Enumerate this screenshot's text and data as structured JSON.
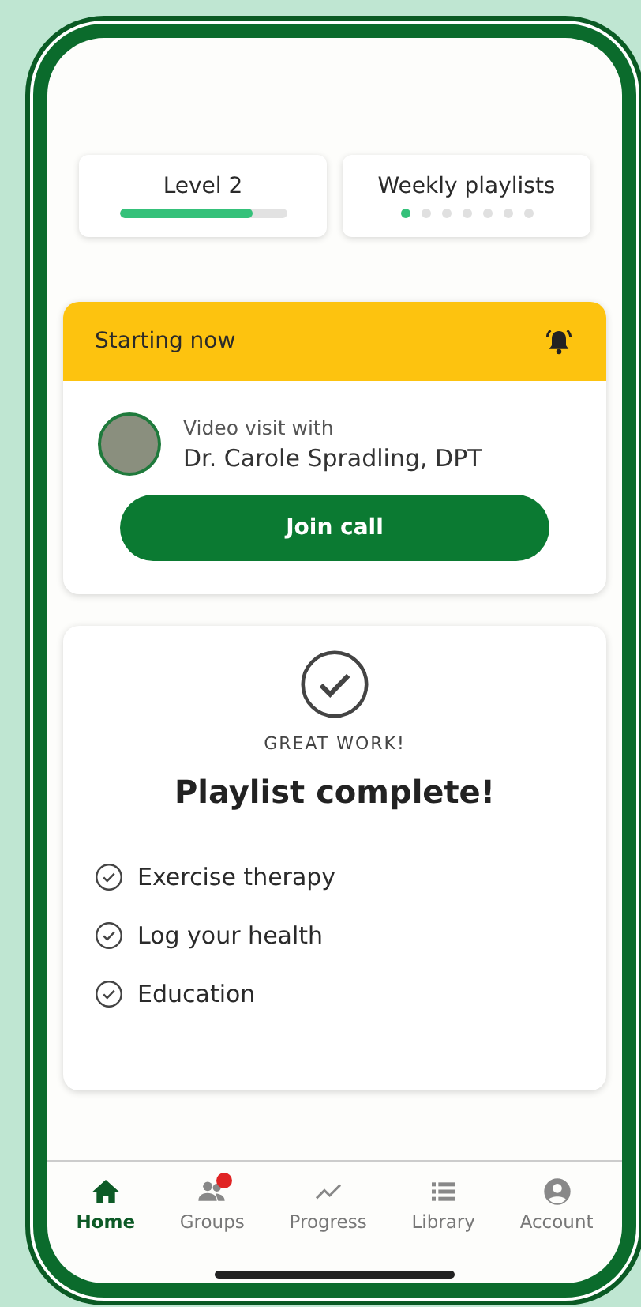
{
  "stats": [
    {
      "kind": "progress",
      "title": "Level 2",
      "level": 0.8
    },
    {
      "kind": "dots",
      "title": "Weekly playlists",
      "dots": [
        {
          "selected": true
        },
        {
          "selected": false
        },
        {
          "selected": false
        },
        {
          "selected": false
        },
        {
          "selected": false
        },
        {
          "selected": false
        },
        {
          "selected": false
        }
      ]
    }
  ],
  "alert": {
    "banner": "Starting now",
    "subtitle": "Video visit with",
    "name": "Dr. Carole Spradling, DPT",
    "button": "Join call"
  },
  "complete": {
    "eyebrow": "GREAT WORK!",
    "title": "Playlist complete!",
    "items": [
      {
        "label": "Exercise therapy",
        "checked": true
      },
      {
        "label": "Log your health",
        "checked": true
      },
      {
        "label": "Education",
        "checked": true
      }
    ]
  },
  "nav": [
    {
      "kind": "home",
      "label": "Home",
      "selected": true,
      "notification": false
    },
    {
      "kind": "groups",
      "label": "Groups",
      "selected": false,
      "notification": true
    },
    {
      "kind": "progress",
      "label": "Progress",
      "selected": false,
      "notification": false
    },
    {
      "kind": "library",
      "label": "Library",
      "selected": false,
      "notification": false
    },
    {
      "kind": "account",
      "label": "Account",
      "selected": false,
      "notification": false
    }
  ]
}
